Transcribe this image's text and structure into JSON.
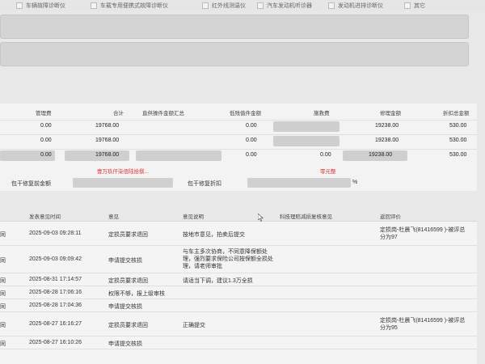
{
  "filters": [
    {
      "label": "车辆故障诊断仪"
    },
    {
      "label": "车载专用便携式故障诊断仪"
    },
    {
      "label": "红外线测温仪"
    },
    {
      "label": "汽车发动机听诊器"
    },
    {
      "label": "发动机进排诊断仪"
    },
    {
      "label": "其它"
    }
  ],
  "fee_table": {
    "headers": {
      "management": "管理费",
      "total": "合计",
      "supplier_parts_total": "直供操件金额汇总",
      "residual_deduction": "低残值件金额",
      "rescue": "施救费",
      "repair_amount": "修理金额",
      "depreciation": "折扣总金额"
    },
    "rows": [
      {
        "management": "0.00",
        "total": "19768.00",
        "supplier_parts_total": "",
        "residual_deduction": "0.00",
        "rescue": "",
        "repair_amount": "19238.00",
        "depreciation": "530.00"
      },
      {
        "management": "0.00",
        "total": "19768.00",
        "supplier_parts_total": "",
        "residual_deduction": "0.00",
        "rescue": "",
        "repair_amount": "19238.00",
        "depreciation": "530.00"
      },
      {
        "management": "0.00",
        "total": "19768.00",
        "supplier_parts_total": "",
        "residual_deduction": "0.00",
        "rescue": "0.00",
        "repair_amount": "19238.00",
        "depreciation": "530.00"
      }
    ],
    "red_note_left": "壹万玖仟柒佰陆拾捌...",
    "red_note_right": "零元整",
    "pre_repair_label": "包干修复前金额",
    "pre_repair_discount_label": "包干修复折扣",
    "percent_sign": "%"
  },
  "log_table": {
    "headers": {
      "time": "发表意见时间",
      "opinion": "意见",
      "opinion_desc": "意见说明",
      "ins_department": "科技理赔减损复核意见",
      "evaluation": "返回评价"
    },
    "rows": [
      {
        "prefix": "同",
        "time": "2025-09-03 09:28:11",
        "opinion": "定损员要求退回",
        "desc": "按地市意见，拍卖后提交",
        "evaluation": "定损岗-杜晨飞(81416599 )-被评总分为97"
      },
      {
        "prefix": "同",
        "time": "2025-09-03 09:09:42",
        "opinion": "申请提交核损",
        "desc": "与车主多次协商，不同意降保额处理，强烈要求保险公司按保额全损处理，请老师审批",
        "evaluation": ""
      },
      {
        "prefix": "同",
        "time": "2025-08-31 17:14:57",
        "opinion": "定损员要求退回",
        "desc": "请适当下调，建议1.3万全损",
        "evaluation": ""
      },
      {
        "prefix": "同",
        "time": "2025-08-28 17:06:16",
        "opinion": "权限不够，报上级审核",
        "desc": "",
        "evaluation": ""
      },
      {
        "prefix": "同",
        "time": "2025-08-28 17:04:36",
        "opinion": "申请提交核损",
        "desc": "",
        "evaluation": ""
      },
      {
        "prefix": "同",
        "time": "2025-08-27 16:16:27",
        "opinion": "定损员要求退回",
        "desc": "正确提交",
        "evaluation": "定损岗-杜晨飞(81416599 )-被评总分为95"
      },
      {
        "prefix": "同",
        "time": "2025-08-27 16:10:26",
        "opinion": "申请提交核损",
        "desc": "",
        "evaluation": ""
      }
    ]
  }
}
